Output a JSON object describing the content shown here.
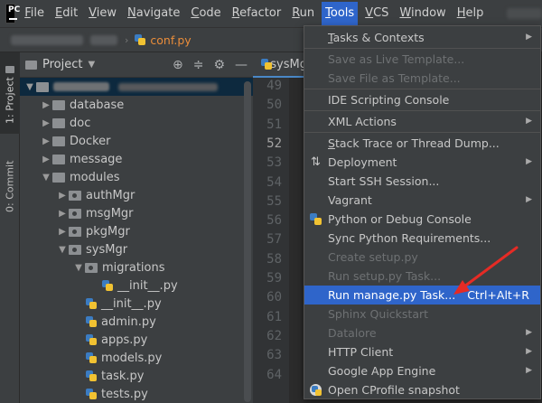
{
  "menubar": {
    "items": [
      {
        "label": "File",
        "u": "F",
        "rest": "ile"
      },
      {
        "label": "Edit",
        "u": "E",
        "rest": "dit"
      },
      {
        "label": "View",
        "u": "V",
        "rest": "iew"
      },
      {
        "label": "Navigate",
        "u": "N",
        "rest": "avigate"
      },
      {
        "label": "Code",
        "u": "C",
        "rest": "ode"
      },
      {
        "label": "Refactor",
        "u": "R",
        "rest": "efactor"
      },
      {
        "label": "Run",
        "u": "R",
        "rest": "un"
      },
      {
        "label": "Tools",
        "u": "T",
        "rest": "ools"
      },
      {
        "label": "VCS",
        "u": "V",
        "rest": "CS"
      },
      {
        "label": "Window",
        "u": "W",
        "rest": "indow"
      },
      {
        "label": "Help",
        "u": "H",
        "rest": "elp"
      }
    ]
  },
  "breadcrumb": {
    "file": "conf.py"
  },
  "toolstrip": {
    "project_tab": "1: Project",
    "commit_tab": "0: Commit"
  },
  "panel": {
    "title": "Project",
    "tree": [
      {
        "label": "database",
        "indent": 1,
        "type": "folder",
        "arrow": "▶"
      },
      {
        "label": "doc",
        "indent": 1,
        "type": "folder",
        "arrow": "▶"
      },
      {
        "label": "Docker",
        "indent": 1,
        "type": "folder",
        "arrow": "▶"
      },
      {
        "label": "message",
        "indent": 1,
        "type": "folder",
        "arrow": "▶"
      },
      {
        "label": "modules",
        "indent": 1,
        "type": "folder",
        "arrow": "▼"
      },
      {
        "label": "authMgr",
        "indent": 2,
        "type": "pkg",
        "arrow": "▶"
      },
      {
        "label": "msgMgr",
        "indent": 2,
        "type": "pkg",
        "arrow": "▶"
      },
      {
        "label": "pkgMgr",
        "indent": 2,
        "type": "pkg",
        "arrow": "▶"
      },
      {
        "label": "sysMgr",
        "indent": 2,
        "type": "pkg",
        "arrow": "▼"
      },
      {
        "label": "migrations",
        "indent": 3,
        "type": "pkg",
        "arrow": "▼"
      },
      {
        "label": "__init__.py",
        "indent": 4,
        "type": "py",
        "arrow": ""
      },
      {
        "label": "__init__.py",
        "indent": 3,
        "type": "py",
        "arrow": ""
      },
      {
        "label": "admin.py",
        "indent": 3,
        "type": "py",
        "arrow": ""
      },
      {
        "label": "apps.py",
        "indent": 3,
        "type": "py",
        "arrow": ""
      },
      {
        "label": "models.py",
        "indent": 3,
        "type": "py",
        "arrow": ""
      },
      {
        "label": "task.py",
        "indent": 3,
        "type": "py",
        "arrow": ""
      },
      {
        "label": "tests.py",
        "indent": 3,
        "type": "py",
        "arrow": ""
      }
    ]
  },
  "editor": {
    "tab_label": "sysMg",
    "line_numbers": [
      "49",
      "50",
      "51",
      "52",
      "53",
      "54",
      "55",
      "56",
      "57",
      "58",
      "59",
      "60",
      "61",
      "62",
      "63",
      "64"
    ],
    "current_line": "52"
  },
  "tools_menu": {
    "items": [
      {
        "label": "Tasks & Contexts",
        "u": "T",
        "rest": "asks & Contexts",
        "submenu": true,
        "disabled": false
      },
      {
        "sep": true
      },
      {
        "label": "Save as Live Template...",
        "u": "",
        "rest": "Save as Live Template...",
        "disabled": true
      },
      {
        "label": "Save File as Template...",
        "u": "",
        "rest": "Save File as Template...",
        "disabled": true
      },
      {
        "sep": true
      },
      {
        "label": "IDE Scripting Console",
        "u": "",
        "rest": "IDE Scripting Console",
        "disabled": false
      },
      {
        "sep": true
      },
      {
        "label": "XML Actions",
        "u": "",
        "rest": "XML Actions",
        "submenu": true,
        "disabled": false
      },
      {
        "sep": true
      },
      {
        "label": "Stack Trace or Thread Dump...",
        "u": "S",
        "rest": "tack Trace or Thread Dump...",
        "disabled": false
      },
      {
        "label": "Deployment",
        "u": "",
        "rest": "Deployment",
        "submenu": true,
        "disabled": false,
        "icon": "deploy"
      },
      {
        "label": "Start SSH Session...",
        "u": "",
        "rest": "Start SSH Session...",
        "disabled": false
      },
      {
        "label": "Vagrant",
        "u": "",
        "rest": "Vagrant",
        "submenu": true,
        "disabled": false
      },
      {
        "label": "Python or Debug Console",
        "u": "",
        "rest": "Python or Debug Console",
        "disabled": false,
        "icon": "py"
      },
      {
        "label": "Sync Python Requirements...",
        "u": "",
        "rest": "Sync Python Requirements...",
        "disabled": false
      },
      {
        "label": "Create setup.py",
        "u": "",
        "rest": "Create setup.py",
        "disabled": true
      },
      {
        "label": "Run setup.py Task...",
        "u": "",
        "rest": "Run setup.py Task...",
        "disabled": true
      },
      {
        "label": "Run manage.py Task...",
        "u": "",
        "rest": "Run manage.py Task...",
        "disabled": false,
        "highlight": true,
        "shortcut": "Ctrl+Alt+R"
      },
      {
        "label": "Sphinx Quickstart",
        "u": "",
        "rest": "Sphinx Quickstart",
        "disabled": true
      },
      {
        "label": "Datalore",
        "u": "",
        "rest": "Datalore",
        "submenu": true,
        "disabled": true
      },
      {
        "label": "HTTP Client",
        "u": "",
        "rest": "HTTP Client",
        "submenu": true,
        "disabled": false
      },
      {
        "label": "Google App Engine",
        "u": "",
        "rest": "Google App Engine",
        "submenu": true,
        "disabled": false
      },
      {
        "label": "Open CProfile snapshot",
        "u": "",
        "rest": "Open CProfile snapshot",
        "disabled": false,
        "icon": "profile"
      }
    ]
  },
  "colors": {
    "accent": "#2f65ca",
    "annotation_arrow": "#e52b25"
  }
}
